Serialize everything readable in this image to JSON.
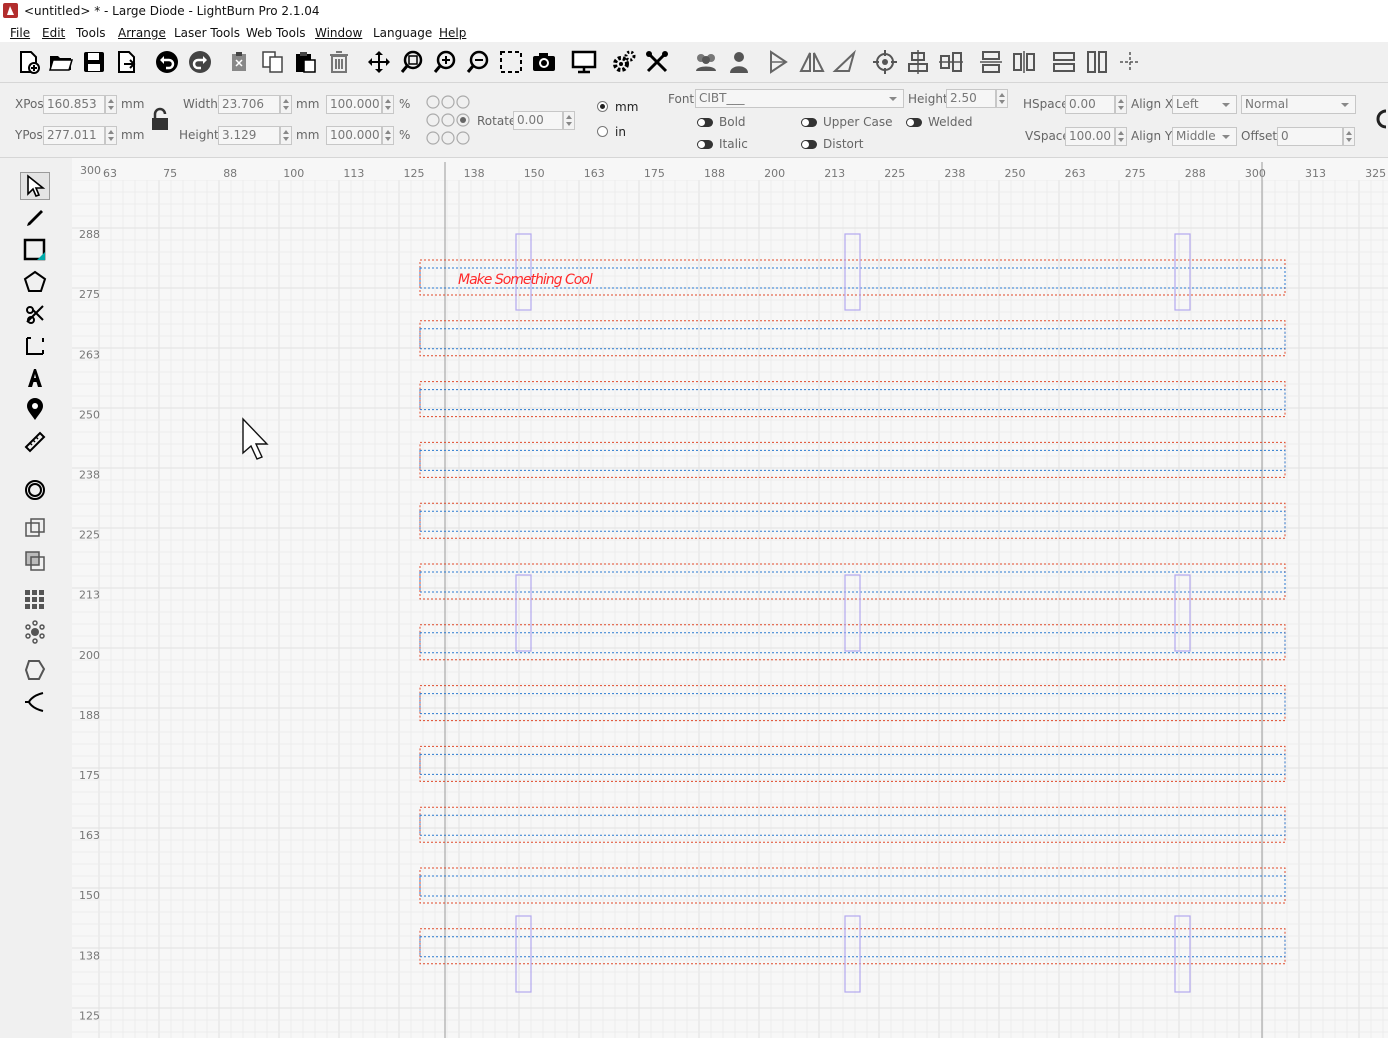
{
  "window": {
    "title": "<untitled> * - Large Diode - LightBurn Pro 2.1.04"
  },
  "menu": [
    {
      "id": "file",
      "label": "File"
    },
    {
      "id": "edit",
      "label": "Edit"
    },
    {
      "id": "tools",
      "label": "Tools"
    },
    {
      "id": "arrange",
      "label": "Arrange"
    },
    {
      "id": "laser-tools",
      "label": "Laser Tools"
    },
    {
      "id": "web-tools",
      "label": "Web Tools"
    },
    {
      "id": "window",
      "label": "Window"
    },
    {
      "id": "language",
      "label": "Language"
    },
    {
      "id": "help",
      "label": "Help"
    }
  ],
  "toolbar_icons": [
    "new-file-icon",
    "open-folder-icon",
    "save-icon",
    "export-icon",
    "undo-icon",
    "redo-icon",
    "cut-icon",
    "copy-icon",
    "paste-icon",
    "delete-icon",
    "move-icon",
    "zoom-frame-icon",
    "zoom-in-icon",
    "zoom-out-icon",
    "select-frame-icon",
    "camera-icon",
    "monitor-icon",
    "settings-gear-icon",
    "tools-wrench-icon",
    "group-icon",
    "ungroup-icon",
    "mirror-vertical-icon",
    "mirror-horizontal-icon",
    "rotate-icon",
    "center-target-icon",
    "align-center-icon",
    "align-middle-icon",
    "distribute-h-icon",
    "distribute-v-icon",
    "make-same-width-icon",
    "make-same-height-icon",
    "dock-icon"
  ],
  "props": {
    "xpos_label": "XPos",
    "xpos_value": "160.853",
    "ypos_label": "YPos",
    "ypos_value": "277.011",
    "unit_mm": "mm",
    "width_label": "Width",
    "width_value": "23.706",
    "height_label": "Height",
    "height_value": "3.129",
    "scale_w": "100.000",
    "scale_h": "100.000",
    "percent": "%",
    "rotate_label": "Rotate",
    "rotate_value": "0.00",
    "units": [
      {
        "label": "mm",
        "selected": true
      },
      {
        "label": "in",
        "selected": false
      }
    ],
    "font_label": "Font",
    "font_value": "CIBT___",
    "font_height_label": "Height",
    "font_height_value": "2.50",
    "hspace_label": "HSpace",
    "hspace_value": "0.00",
    "vspace_label": "VSpace",
    "vspace_value": "100.00",
    "alignx_label": "Align X",
    "alignx_value": "Left",
    "aligny_label": "Align Y",
    "aligny_value": "Middle",
    "mode_value": "Normal",
    "offset_label": "Offset",
    "offset_value": "0",
    "bold": "Bold",
    "italic": "Italic",
    "upper_case": "Upper Case",
    "distort": "Distort",
    "welded": "Welded"
  },
  "left_tools": [
    "select-tool-icon",
    "draw-lines-icon",
    "rectangle-icon",
    "polygon-icon",
    "edit-nodes-icon",
    "corner-tool-icon",
    "text-tool-icon",
    "position-laser-icon",
    "measure-icon",
    "offset-icon",
    "boolean-union-icon",
    "boolean-subtract-icon",
    "grid-array-icon",
    "circular-array-icon",
    "convert-path-icon",
    "tabs-tool-icon"
  ],
  "rulers": {
    "x_ticks": [
      "63",
      "75",
      "88",
      "100",
      "113",
      "125",
      "138",
      "150",
      "163",
      "175",
      "188",
      "200",
      "213",
      "225",
      "238",
      "250",
      "263",
      "275",
      "288",
      "300",
      "313",
      "325"
    ],
    "y_ticks": [
      "300",
      "288",
      "275",
      "263",
      "250",
      "238",
      "225",
      "213",
      "200",
      "188",
      "175",
      "163",
      "150",
      "138",
      "125"
    ]
  },
  "canvas": {
    "text_object": "Make Something Cool",
    "text_color": "#ff2a2a",
    "row_count": 12,
    "outer_line_color": "#e04a2a",
    "inner_line_color": "#2a7ad0",
    "vertical_marker_color": "#b4a8ee"
  }
}
